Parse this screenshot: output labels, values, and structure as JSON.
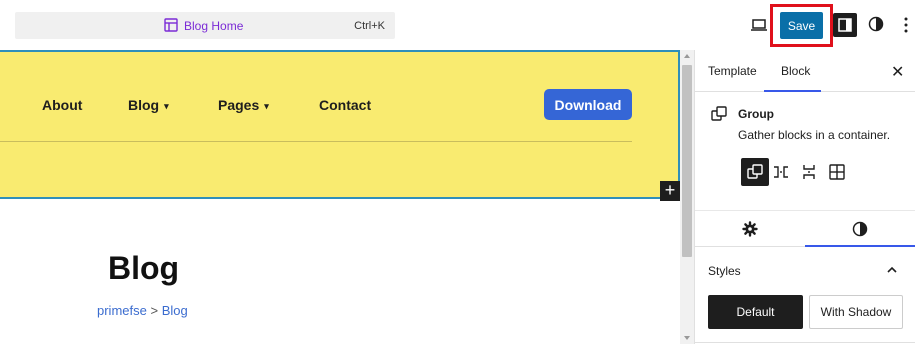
{
  "topbar": {
    "command_title": "Blog Home",
    "shortcut": "Ctrl+K",
    "save_label": "Save",
    "colors": {
      "accent": "#0a6fa8",
      "highlight_box": "#e0101b",
      "title": "#7b2bd6"
    }
  },
  "canvas": {
    "nav": [
      {
        "label": "About",
        "has_caret": false
      },
      {
        "label": "Blog",
        "caret": "▾"
      },
      {
        "label": "Pages",
        "caret": "▾"
      },
      {
        "label": "Contact",
        "has_caret": false
      }
    ],
    "download_label": "Download",
    "add_block": "+",
    "page_title": "Blog",
    "breadcrumb": {
      "site": "primefse",
      "separator": ">",
      "current": "Blog"
    },
    "colors": {
      "header_bg": "#f9eb70",
      "button": "#3566d6",
      "selection": "#2f8fba"
    }
  },
  "sidebar": {
    "tabs": [
      {
        "label": "Template"
      },
      {
        "label": "Block"
      }
    ],
    "active_tab": "Block",
    "close": "✕",
    "block": {
      "name": "Group",
      "description": "Gather blocks in a container."
    },
    "variation_icons": [
      "group-icon",
      "row-icon",
      "stack-icon",
      "grid-icon"
    ],
    "sub_tab_icons": [
      "settings-gear-icon",
      "styles-contrast-icon"
    ],
    "styles": {
      "label": "Styles",
      "options": [
        {
          "label": "Default"
        },
        {
          "label": "With Shadow"
        }
      ]
    }
  }
}
